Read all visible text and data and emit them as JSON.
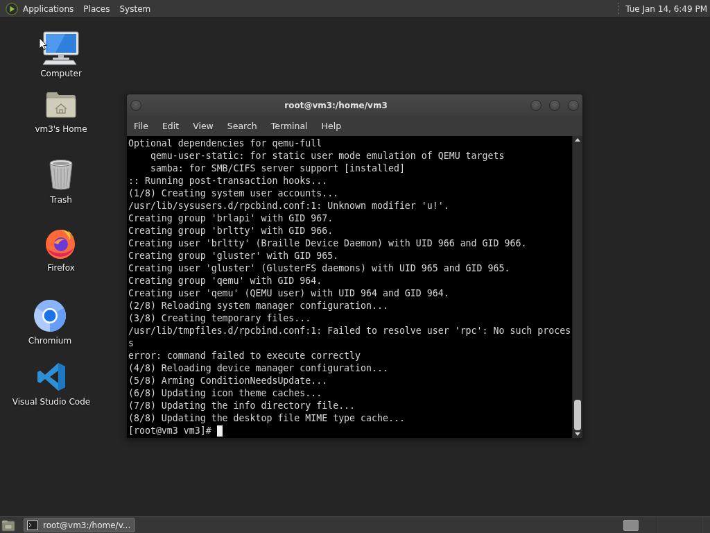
{
  "top_panel": {
    "menus": [
      "Applications",
      "Places",
      "System"
    ],
    "clock": "Tue Jan 14, 6:49 PM"
  },
  "desktop_icons": [
    {
      "kind": "computer",
      "label": "Computer"
    },
    {
      "kind": "home",
      "label": "vm3's Home"
    },
    {
      "kind": "trash",
      "label": "Trash"
    },
    {
      "kind": "firefox",
      "label": "Firefox"
    },
    {
      "kind": "chromium",
      "label": "Chromium"
    },
    {
      "kind": "vscode",
      "label": "Visual Studio Code"
    }
  ],
  "terminal": {
    "title": "root@vm3:/home/vm3",
    "menus": [
      "File",
      "Edit",
      "View",
      "Search",
      "Terminal",
      "Help"
    ],
    "lines": [
      "Optional dependencies for qemu-full",
      "    qemu-user-static: for static user mode emulation of QEMU targets",
      "    samba: for SMB/CIFS server support [installed]",
      ":: Running post-transaction hooks...",
      "(1/8) Creating system user accounts...",
      "/usr/lib/sysusers.d/rpcbind.conf:1: Unknown modifier 'u!'.",
      "Creating group 'brlapi' with GID 967.",
      "Creating group 'brltty' with GID 966.",
      "Creating user 'brltty' (Braille Device Daemon) with UID 966 and GID 966.",
      "Creating group 'gluster' with GID 965.",
      "Creating user 'gluster' (GlusterFS daemons) with UID 965 and GID 965.",
      "Creating group 'qemu' with GID 964.",
      "Creating user 'qemu' (QEMU user) with UID 964 and GID 964.",
      "(2/8) Reloading system manager configuration...",
      "(3/8) Creating temporary files...",
      "/usr/lib/tmpfiles.d/rpcbind.conf:1: Failed to resolve user 'rpc': No such proces",
      "s",
      "error: command failed to execute correctly",
      "(4/8) Reloading device manager configuration...",
      "(5/8) Arming ConditionNeedsUpdate...",
      "(6/8) Updating icon theme caches...",
      "(7/8) Updating the info directory file...",
      "(8/8) Updating the desktop file MIME type cache..."
    ],
    "prompt": "[root@vm3 vm3]#"
  },
  "taskbar": {
    "tasks": [
      {
        "label": "root@vm3:/home/v...",
        "selected": true
      }
    ]
  }
}
